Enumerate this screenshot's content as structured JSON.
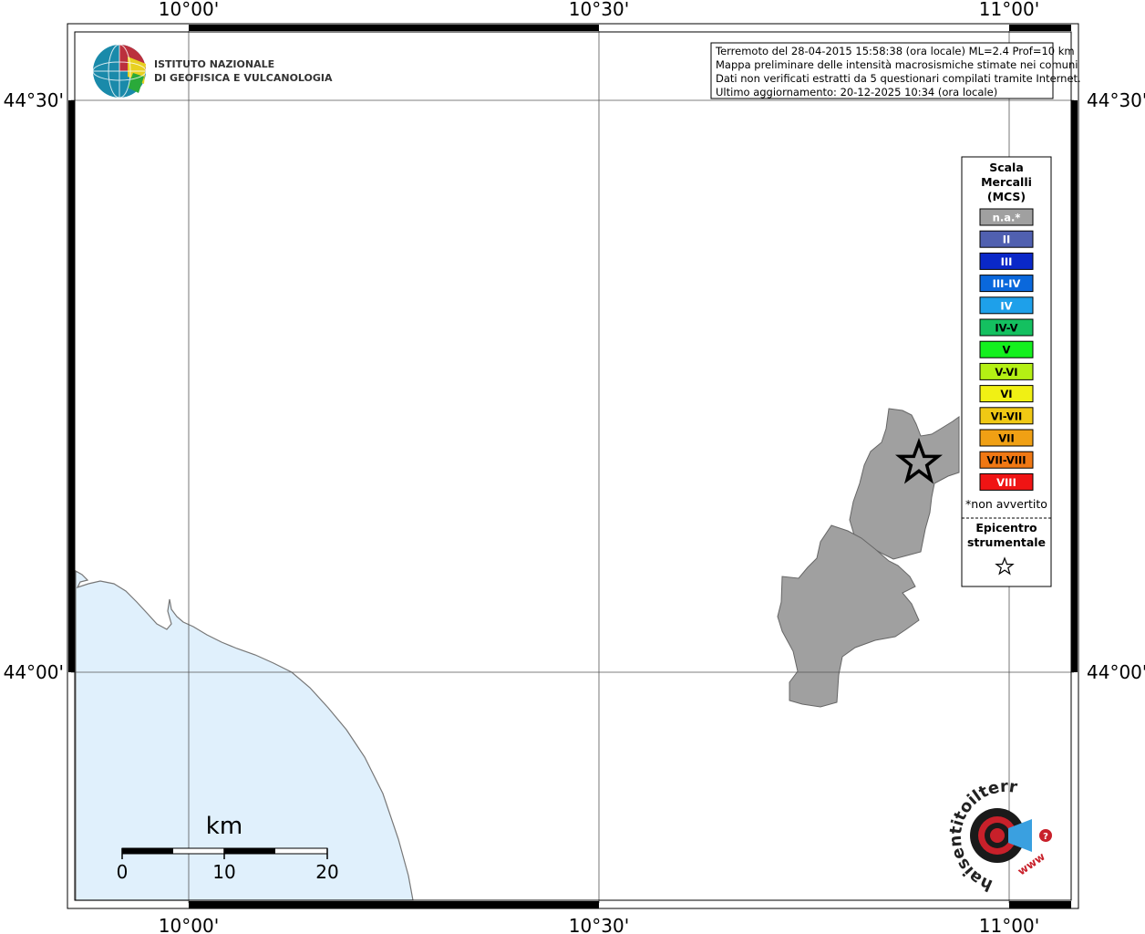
{
  "map": {
    "ticks": {
      "lon": [
        "10°00'",
        "10°30'",
        "11°00'"
      ],
      "lat": [
        "44°30'",
        "44°00'"
      ]
    },
    "info_box": {
      "lines": [
        "Terremoto del 28-04-2015 15:58:38 (ora locale) ML=2.4 Prof=10 km",
        "Mappa preliminare delle intensità macrosismiche stimate nei comuni",
        "Dati non verificati estratti da 5 questionari compilati tramite Internet.",
        "Ultimo aggiornamento: 20-12-2025 10:34 (ora locale)"
      ]
    },
    "logo": {
      "line1": "ISTITUTO NAZIONALE",
      "line2": "DI GEOFISICA E VULCANOLOGIA"
    },
    "legend": {
      "title": [
        "Scala",
        "Mercalli",
        "(MCS)"
      ],
      "classes": [
        {
          "label": "n.a.*",
          "color": "#a0a0a0",
          "text": "#ffffff"
        },
        {
          "label": "II",
          "color": "#5060b0",
          "text": "#ffffff"
        },
        {
          "label": "III",
          "color": "#0a28c8",
          "text": "#ffffff"
        },
        {
          "label": "III-IV",
          "color": "#0a68dc",
          "text": "#ffffff"
        },
        {
          "label": "IV",
          "color": "#1ea0ea",
          "text": "#ffffff"
        },
        {
          "label": "IV-V",
          "color": "#14c060",
          "text": "#000000"
        },
        {
          "label": "V",
          "color": "#14f01e",
          "text": "#000000"
        },
        {
          "label": "V-VI",
          "color": "#b4f014",
          "text": "#000000"
        },
        {
          "label": "VI",
          "color": "#f0f014",
          "text": "#000000"
        },
        {
          "label": "VI-VII",
          "color": "#f0c814",
          "text": "#000000"
        },
        {
          "label": "VII",
          "color": "#f0a014",
          "text": "#000000"
        },
        {
          "label": "VII-VIII",
          "color": "#f07814",
          "text": "#000000"
        },
        {
          "label": "VIII",
          "color": "#f01414",
          "text": "#ffffff"
        }
      ],
      "footnote": "*non avvertito",
      "epicenter_label": [
        "Epicentro",
        "strumentale"
      ]
    },
    "scale_bar": {
      "unit": "km",
      "labels": [
        "0",
        "10",
        "20"
      ]
    },
    "colors": {
      "sea": "#e0f0fc",
      "affected_municipality": "#a0a0a0",
      "frame": "#000000"
    },
    "watermark": {
      "text": "haisentitoilterremoto.it",
      "url": "www"
    }
  }
}
